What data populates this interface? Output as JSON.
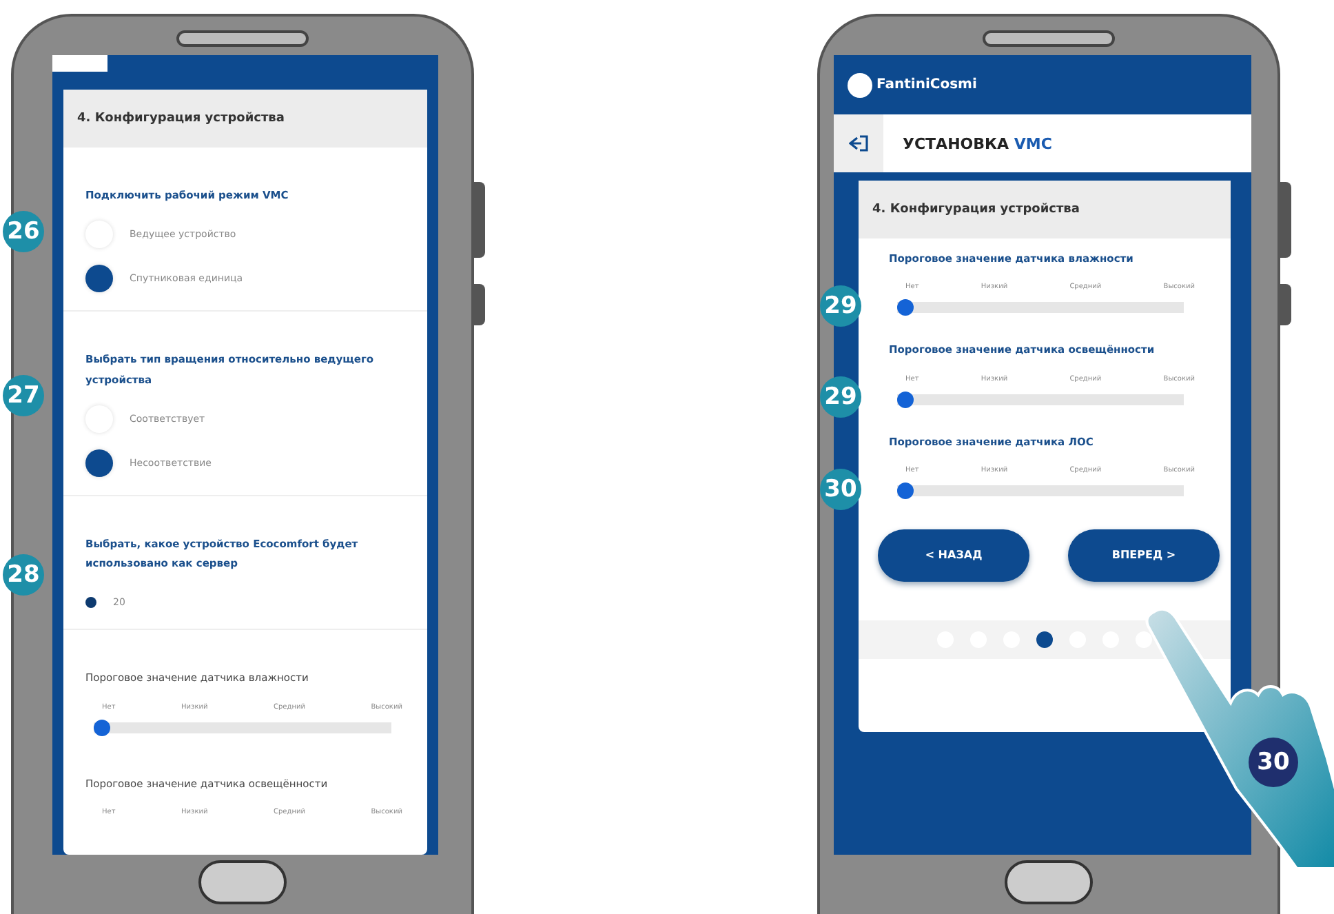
{
  "left_phone": {
    "card_title": "4. Конфигурация устройства",
    "sections": [
      {
        "kind": "radio",
        "callout": "26",
        "title": "Подключить рабочий режим VMC",
        "options": [
          {
            "label": "Ведущее устройство",
            "selected": false
          },
          {
            "label": "Спутниковая единица",
            "selected": true
          }
        ]
      },
      {
        "kind": "radio",
        "callout": "27",
        "title": "Выбрать тип вращения относительно ведущего устройства",
        "options": [
          {
            "label": "Соответствует",
            "selected": false
          },
          {
            "label": "Несоответствие",
            "selected": true
          }
        ]
      },
      {
        "kind": "dot",
        "callout": "28",
        "title": "Выбрать, какое устройство Ecocomfort будет использовано как сервер",
        "options": [
          {
            "label": "20",
            "selected": true
          }
        ]
      },
      {
        "kind": "slider",
        "title": "Пороговое значение датчика влажности",
        "ticks": [
          "Нет",
          "Низкий",
          "Средний",
          "Высокий"
        ],
        "level": 0
      },
      {
        "kind": "slider",
        "title": "Пороговое значение датчика освещённости",
        "ticks": [
          "Нет",
          "Низкий",
          "Средний",
          "Высокий"
        ]
      }
    ]
  },
  "right_phone": {
    "logo": "FantiniCosmi",
    "page_title": "УСТАНОВКА",
    "page_title_highlight": "VMC",
    "card_title": "4. Конфигурация устройства",
    "sections": [
      {
        "kind": "slider",
        "callout": "29",
        "title": "Пороговое значение датчика влажности",
        "ticks": [
          "Нет",
          "Низкий",
          "Средний",
          "Высокий"
        ],
        "level": 0
      },
      {
        "kind": "slider",
        "callout": "29",
        "title": "Пороговое значение датчика освещённости",
        "ticks": [
          "Нет",
          "Низкий",
          "Средний",
          "Высокий"
        ],
        "level": 0
      },
      {
        "kind": "slider",
        "callout": "30",
        "title": "Пороговое значение датчика ЛОС",
        "ticks": [
          "Нет",
          "Низкий",
          "Средний",
          "Высокий"
        ],
        "level": 0
      }
    ],
    "buttons": [
      {
        "label": "< НАЗАД"
      },
      {
        "label": "ВПЕРЕД >"
      }
    ],
    "steps": [
      {
        "selected": false
      },
      {
        "selected": false
      },
      {
        "selected": false
      },
      {
        "selected": true
      },
      {
        "selected": false
      },
      {
        "selected": false
      },
      {
        "selected": false
      }
    ],
    "hand_callout": "30"
  }
}
